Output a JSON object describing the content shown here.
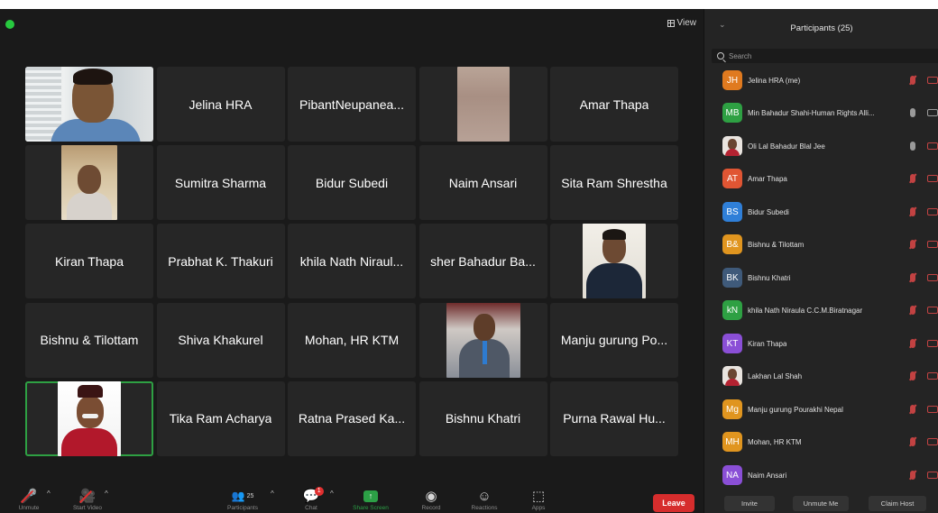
{
  "gallery": {
    "view_label": "View",
    "tiles": [
      {
        "name": "",
        "photo": "office"
      },
      {
        "name": "Jelina HRA"
      },
      {
        "name": "PibantNeupanea..."
      },
      {
        "name": "",
        "photo": "skin"
      },
      {
        "name": "Amar Thapa"
      },
      {
        "name": "",
        "photo": "man2"
      },
      {
        "name": "Sumitra Sharma"
      },
      {
        "name": "Bidur Subedi"
      },
      {
        "name": "Naim Ansari"
      },
      {
        "name": "Sita Ram Shrestha"
      },
      {
        "name": "Kiran Thapa"
      },
      {
        "name": "Prabhat K. Thakuri"
      },
      {
        "name": "khila Nath Niraul..."
      },
      {
        "name": "sher Bahadur Ba..."
      },
      {
        "name": "",
        "photo": "man3"
      },
      {
        "name": "Bishnu & Tilottam"
      },
      {
        "name": "Shiva Khakurel"
      },
      {
        "name": "Mohan, HR KTM"
      },
      {
        "name": "",
        "photo": "man4"
      },
      {
        "name": "Manju gurung Po..."
      },
      {
        "name": "",
        "photo": "man5",
        "active": true
      },
      {
        "name": "Tika Ram Acharya"
      },
      {
        "name": "Ratna Prased Ka..."
      },
      {
        "name": "Bishnu Khatri"
      },
      {
        "name": "Purna Rawal Hu..."
      }
    ]
  },
  "toolbar": {
    "unmute_label": "Unmute",
    "start_video_label": "Start Video",
    "participants_count": "25",
    "participants_label": "Participants",
    "chat_label": "Chat",
    "chat_badge": "1",
    "share_label": "Share Screen",
    "record_label": "Record",
    "reactions_label": "Reactions",
    "apps_label": "Apps",
    "leave_label": "Leave"
  },
  "panel": {
    "title": "Participants (25)",
    "search_placeholder": "Search",
    "participants": [
      {
        "initials": "JH",
        "color": "#e07a1f",
        "name": "Jelina HRA (me)",
        "mic": "off",
        "cam": "off"
      },
      {
        "initials": "MB",
        "color": "#2ea043",
        "name": "Min Bahadur Shahi-Human Rights Alli...",
        "mic": "on",
        "cam": "on"
      },
      {
        "initials": "",
        "photo": true,
        "name": "Oli Lal Bahadur Blal Jee",
        "mic": "on",
        "cam": "off"
      },
      {
        "initials": "AT",
        "color": "#e05533",
        "name": "Amar Thapa",
        "mic": "off",
        "cam": "off"
      },
      {
        "initials": "BS",
        "color": "#2f7fd8",
        "name": "Bidur Subedi",
        "mic": "off",
        "cam": "off"
      },
      {
        "initials": "B&",
        "color": "#e0951f",
        "name": "Bishnu & Tilottam",
        "mic": "off",
        "cam": "off"
      },
      {
        "initials": "BK",
        "color": "#3f5a7a",
        "name": "Bishnu Khatri",
        "mic": "off",
        "cam": "off"
      },
      {
        "initials": "kN",
        "color": "#2ea043",
        "name": "khila Nath Niraula C.C.M.Biratnagar",
        "mic": "off",
        "cam": "off"
      },
      {
        "initials": "KT",
        "color": "#8a4fd6",
        "name": "Kiran Thapa",
        "mic": "off",
        "cam": "off"
      },
      {
        "initials": "",
        "photo": true,
        "name": "Lakhan Lal Shah",
        "mic": "off",
        "cam": "off"
      },
      {
        "initials": "Mg",
        "color": "#e0951f",
        "name": "Manju gurung Pourakhi Nepal",
        "mic": "off",
        "cam": "off"
      },
      {
        "initials": "MH",
        "color": "#e0951f",
        "name": "Mohan, HR KTM",
        "mic": "off",
        "cam": "off"
      },
      {
        "initials": "NA",
        "color": "#8a4fd6",
        "name": "Naim Ansari",
        "mic": "off",
        "cam": "off"
      }
    ],
    "invite_label": "Invite",
    "unmute_me_label": "Unmute Me",
    "claim_host_label": "Claim Host"
  },
  "colors": {
    "accent_green": "#2ea043",
    "leave_red": "#d62d2d",
    "background": "#1a1a1a"
  }
}
